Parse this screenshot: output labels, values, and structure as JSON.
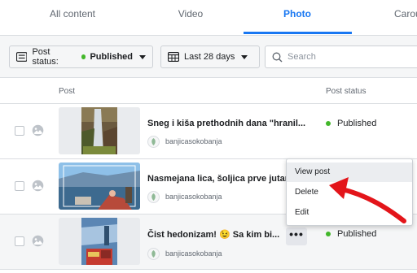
{
  "tabs": [
    {
      "label": "All content"
    },
    {
      "label": "Video"
    },
    {
      "label": "Photo"
    },
    {
      "label": "Carou"
    }
  ],
  "filters": {
    "status_prefix": "Post status:",
    "status_value": "Published",
    "date_range": "Last 28 days",
    "search_placeholder": "Search"
  },
  "table": {
    "col_post": "Post",
    "col_status": "Post status"
  },
  "rows": [
    {
      "title": "Sneg i kiša prethodnih dana \"hranil...",
      "author": "banjicasokobanja",
      "status": "Published"
    },
    {
      "title": "Nasmejana lica, šoljica prve jutar",
      "author": "banjicasokobanja",
      "status": ""
    },
    {
      "title": "Čist hedonizam! 😉 Sa kim bi...",
      "author": "banjicasokobanja",
      "status": "Published"
    }
  ],
  "more_button": "•••",
  "menu": {
    "items": [
      "View post",
      "Delete",
      "Edit"
    ]
  },
  "colors": {
    "accent": "#1877f2",
    "published": "#42b72a",
    "annotation": "#e3151a"
  }
}
